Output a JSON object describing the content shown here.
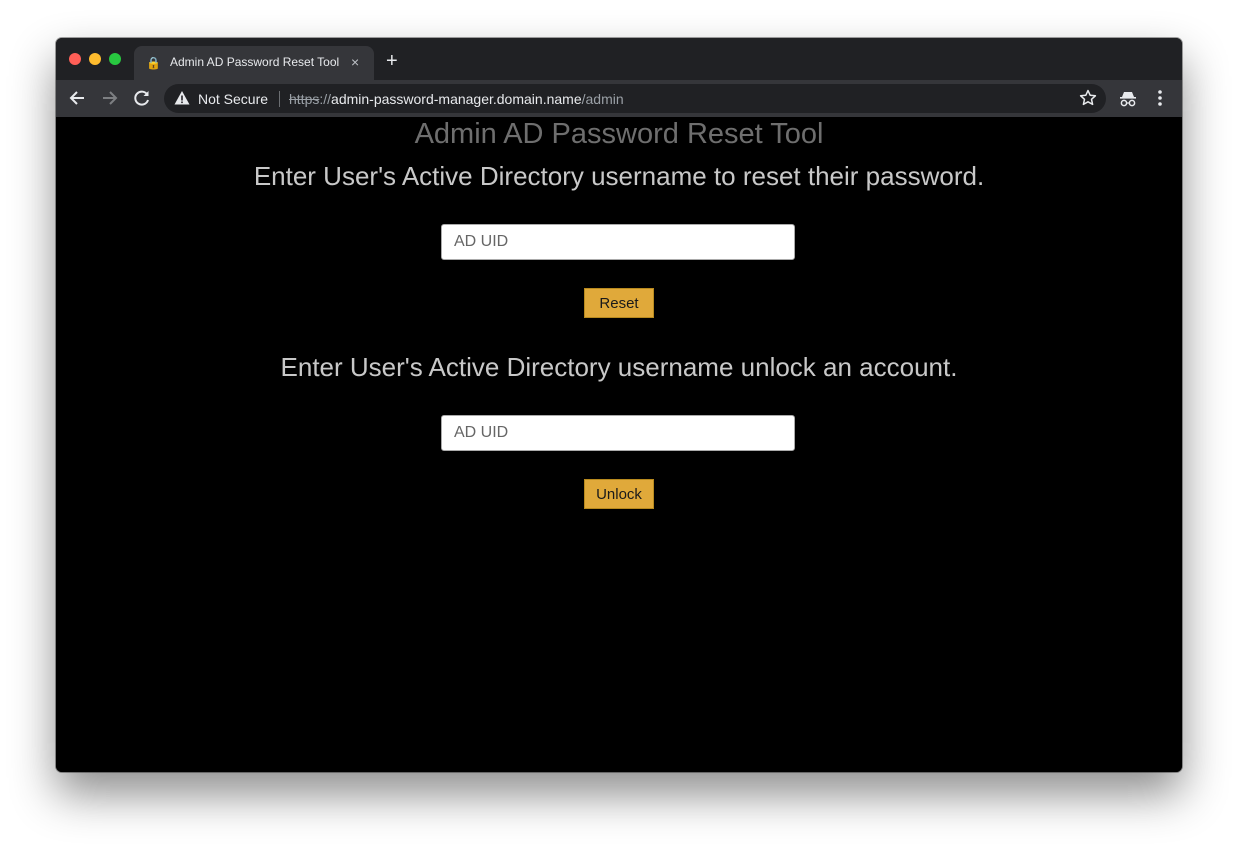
{
  "browser": {
    "tab_title": "Admin AD Password Reset Tool",
    "tab_close": "×",
    "new_tab": "+",
    "security_label": "Not Secure",
    "url_scheme": "https",
    "url_sep": "://",
    "url_host": "admin-password-manager.domain.name",
    "url_path": "/admin",
    "icons": {
      "back": "back-arrow-icon",
      "forward": "forward-arrow-icon",
      "reload": "reload-icon",
      "warning": "warning-icon",
      "bookmark": "star-icon",
      "incognito": "incognito-icon",
      "menu": "kebab-menu-icon"
    }
  },
  "page": {
    "title": "Admin AD Password Reset Tool",
    "reset_section": {
      "heading": "Enter User's Active Directory username to reset their password.",
      "input_placeholder": "AD UID",
      "button_label": "Reset"
    },
    "unlock_section": {
      "heading": "Enter User's Active Directory username unlock an account.",
      "input_placeholder": "AD UID",
      "button_label": "Unlock"
    }
  },
  "colors": {
    "button_bg": "#e0a93a",
    "page_bg": "#000000",
    "heading": "#c8c8c8",
    "title": "#6e6e6e"
  }
}
